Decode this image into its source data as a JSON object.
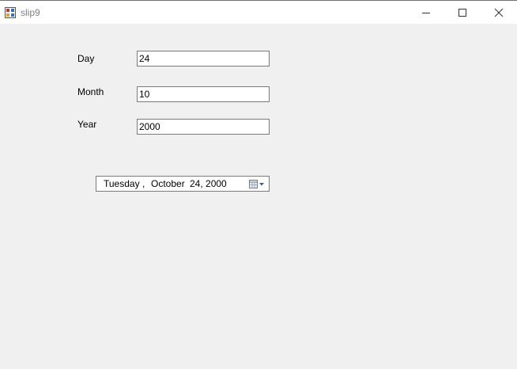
{
  "window": {
    "title": "slip9"
  },
  "form": {
    "day_label": "Day",
    "day_value": "24",
    "month_label": "Month",
    "month_value": "10",
    "year_label": "Year",
    "year_value": "2000"
  },
  "datepicker": {
    "weekday": "Tuesday",
    "separator": ",",
    "month": "October",
    "day_year": "24, 2000"
  },
  "icons": {
    "app": "app-icon",
    "minimize": "minimize-icon",
    "maximize": "maximize-icon",
    "close": "close-icon",
    "calendar": "calendar-icon"
  }
}
